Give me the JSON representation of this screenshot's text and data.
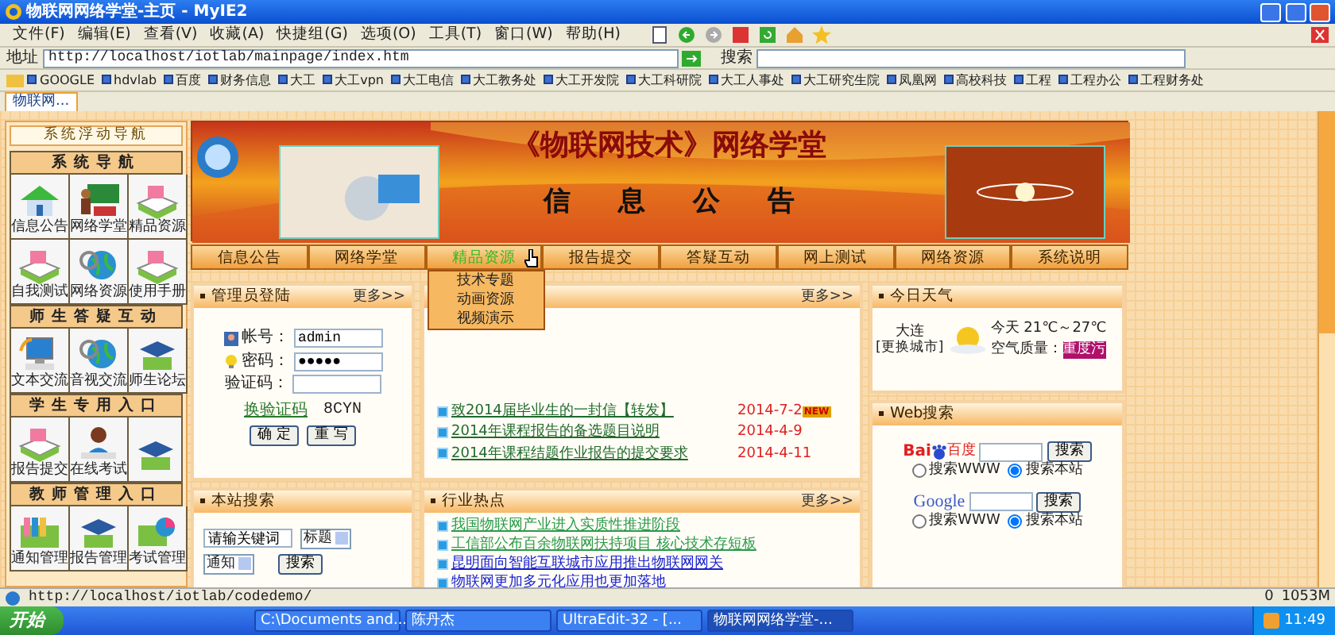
{
  "window": {
    "title": "物联网网络学堂-主页 - MyIE2"
  },
  "menu": [
    "文件(F)",
    "编辑(E)",
    "查看(V)",
    "收藏(A)",
    "快捷组(G)",
    "选项(O)",
    "工具(T)",
    "窗口(W)",
    "帮助(H)"
  ],
  "address": {
    "label": "地址",
    "url": "http://localhost/iotlab/mainpage/index.htm",
    "search_label": "搜索"
  },
  "links": [
    "GOOGLE",
    "hdvlab",
    "百度",
    "财务信息",
    "大工",
    "大工vpn",
    "大工电信",
    "大工教务处",
    "大工开发院",
    "大工科研院",
    "大工人事处",
    "大工研究生院",
    "凤凰网",
    "高校科技",
    "工程",
    "工程办公",
    "工程财务处"
  ],
  "tabs": [
    {
      "label": "物联网...",
      "selected": true
    }
  ],
  "sidebar": {
    "title": "系统浮动导航",
    "sections": [
      {
        "title": "系统导航",
        "items": [
          {
            "kind": "labeled",
            "label": "信息公告"
          },
          {
            "kind": "labeled",
            "label": "网络学堂"
          },
          {
            "kind": "labeled",
            "label": "精品资源"
          },
          {
            "kind": "labeled",
            "label": "自我测试"
          },
          {
            "kind": "labeled",
            "label": "网络资源"
          },
          {
            "kind": "labeled",
            "label": "使用手册"
          }
        ]
      },
      {
        "title": "师生答疑互动",
        "items": [
          {
            "kind": "labeled",
            "label": "文本交流"
          },
          {
            "kind": "labeled",
            "label": "音视交流"
          },
          {
            "kind": "labeled",
            "label": "师生论坛"
          }
        ]
      },
      {
        "title": "学生专用入口",
        "items": [
          {
            "kind": "labeled",
            "label": "报告提交"
          },
          {
            "kind": "labeled",
            "label": "在线考试"
          },
          {
            "kind": "unlabeled"
          }
        ]
      },
      {
        "title": "教师管理入口",
        "items": [
          {
            "kind": "labeled",
            "label": "通知管理"
          },
          {
            "kind": "labeled",
            "label": "报告管理"
          },
          {
            "kind": "labeled",
            "label": "考试管理"
          }
        ]
      }
    ]
  },
  "banner": {
    "title": "《物联网技术》网络学堂",
    "subtitle": "信息公告"
  },
  "nav": [
    {
      "label": "信息公告",
      "selected": false
    },
    {
      "label": "网络学堂",
      "selected": false
    },
    {
      "label": "精品资源",
      "selected": true
    },
    {
      "label": "报告提交",
      "selected": false
    },
    {
      "label": "答疑互动",
      "selected": false
    },
    {
      "label": "网上测试",
      "selected": false
    },
    {
      "label": "网络资源",
      "selected": false
    },
    {
      "label": "系统说明",
      "selected": false
    }
  ],
  "dropdown": [
    "技术专题",
    "动画资源",
    "视频演示"
  ],
  "login": {
    "title": "管理员登陆",
    "more": "更多>>",
    "fields": [
      {
        "label": "帐号：",
        "value": "admin"
      },
      {
        "label": "密码：",
        "value": "●●●●●"
      },
      {
        "label": "验证码："
      }
    ],
    "captcha_link": "换验证码",
    "captcha": "8CYN",
    "buttons": [
      "确 定",
      "重 写"
    ]
  },
  "site_search": {
    "title": "本站搜索",
    "keyword": "请输关键词",
    "field_select": "标题",
    "type_select": "通知",
    "button": "搜索"
  },
  "news": {
    "more": "更多>>",
    "items": [
      {
        "title": "致2014届毕业生的一封信【转发】",
        "date": "2014-7-2",
        "badge": "NEW"
      },
      {
        "title": "2014年课程报告的备选题目说明",
        "date": "2014-4-9"
      },
      {
        "title": "2014年课程结题作业报告的提交要求",
        "date": "2014-4-11"
      }
    ]
  },
  "hot": {
    "title": "行业热点",
    "more": "更多>>",
    "items": [
      {
        "title": "我国物联网产业进入实质性推进阶段",
        "visited": true
      },
      {
        "title": "工信部公布百余物联网扶持项目 核心技术存短板",
        "visited": true
      },
      {
        "title": "昆明面向智能互联城市应用推出物联网网关",
        "visited": false
      },
      {
        "title": "物联网更加多元化应用也更加落地",
        "visited": false
      }
    ]
  },
  "weather": {
    "title": "今日天气",
    "city": "大连",
    "change": "[更换城市]",
    "today": "今天",
    "temp": "21℃～27℃",
    "air_label": "空气质量：",
    "air": "重度污"
  },
  "web_search": {
    "title": "Web搜索",
    "engines": [
      {
        "kind": "baidu",
        "logo": "Bai",
        "logo_cn": "百度",
        "button": "搜索",
        "options": [
          {
            "label": "搜索WWW",
            "selected": false
          },
          {
            "label": "搜索本站",
            "selected": true
          }
        ]
      },
      {
        "kind": "google",
        "logo": "Google",
        "button": "搜索",
        "options": [
          {
            "label": "搜索WWW",
            "selected": false
          },
          {
            "label": "搜索本站",
            "selected": true
          }
        ]
      }
    ]
  },
  "status_bar": {
    "url": "http://localhost/iotlab/codedemo/",
    "count": "0",
    "memory": "1053M"
  },
  "taskbar": {
    "start": "开始",
    "tasks": [
      {
        "label": "C:\\Documents and...",
        "selected": false
      },
      {
        "label": "陈丹杰",
        "selected": false
      },
      {
        "label": "UltraEdit-32 - [...",
        "selected": false
      },
      {
        "label": "物联网网络学堂-...",
        "selected": true
      }
    ],
    "clock": "11:49"
  }
}
